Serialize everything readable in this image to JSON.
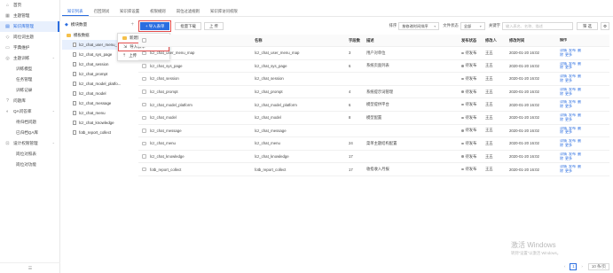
{
  "nav": {
    "items": [
      {
        "label": "首页",
        "icon": "home-icon",
        "type": "top"
      },
      {
        "label": "主题管理",
        "icon": "grid-icon",
        "type": "top"
      },
      {
        "label": "知识库管理",
        "icon": "book-icon",
        "type": "active"
      },
      {
        "label": "岗位词主题",
        "icon": "tag-icon",
        "type": "top"
      },
      {
        "label": "字典维护",
        "icon": "dict-icon",
        "type": "top"
      },
      {
        "label": "主题训练",
        "icon": "train-icon",
        "type": "group"
      },
      {
        "label": "训练模型",
        "icon": "",
        "type": "sub"
      },
      {
        "label": "任务管理",
        "icon": "",
        "type": "sub"
      },
      {
        "label": "训练记录",
        "icon": "",
        "type": "sub"
      },
      {
        "label": "问题库",
        "icon": "question-icon",
        "type": "top"
      },
      {
        "label": "QA问答库",
        "icon": "qa-icon",
        "type": "group"
      },
      {
        "label": "待归档问题",
        "icon": "",
        "type": "sub"
      },
      {
        "label": "已归档QA库",
        "icon": "",
        "type": "sub"
      },
      {
        "label": "设计权限管理",
        "icon": "lock-icon",
        "type": "group"
      },
      {
        "label": "岗位对照表",
        "icon": "",
        "type": "sub"
      },
      {
        "label": "岗位对功能",
        "icon": "",
        "type": "sub"
      }
    ],
    "footer_icon": "collapse-icon"
  },
  "tabs": [
    {
      "label": "知识列表",
      "active": true
    },
    {
      "label": "召回测试",
      "active": false
    },
    {
      "label": "知识库设置",
      "active": false
    },
    {
      "label": "权限规则",
      "active": false
    },
    {
      "label": "岗位过滤规则",
      "active": false
    },
    {
      "label": "知识库访问权限",
      "active": false
    }
  ],
  "tree": {
    "root_label": "模块数量",
    "root_plus": "+",
    "nodes": [
      {
        "label": "模板数据",
        "kind": "folder",
        "level": 0
      },
      {
        "label": "lcz_chat_user_menu_m...",
        "kind": "file",
        "level": 1
      },
      {
        "label": "lcz_chat_sys_page",
        "kind": "file",
        "level": 1
      },
      {
        "label": "lcz_chat_session",
        "kind": "file",
        "level": 1
      },
      {
        "label": "lcz_chat_prompt",
        "kind": "file",
        "level": 1
      },
      {
        "label": "lcz_chat_model_platfo...",
        "kind": "file",
        "level": 1
      },
      {
        "label": "lcz_chat_model",
        "kind": "file",
        "level": 1
      },
      {
        "label": "lcz_chat_message",
        "kind": "file",
        "level": 1
      },
      {
        "label": "lcz_chat_menu",
        "kind": "file",
        "level": 1
      },
      {
        "label": "lcz_chat_knowledge",
        "kind": "file",
        "level": 1
      },
      {
        "label": "fotb_report_collect",
        "kind": "file",
        "level": 1
      }
    ]
  },
  "context_menu": {
    "items": [
      {
        "label": "新建目录",
        "icon": "folder-icon"
      },
      {
        "label": "导入表单",
        "icon": "import-icon",
        "highlight": true
      },
      {
        "label": "上传",
        "icon": "upload-icon"
      }
    ]
  },
  "toolbar": {
    "import_label": "+ 导入表单",
    "download_label": "批量下载",
    "upload_label": "上 传",
    "sort_label": "排序",
    "sort_value": "按修改时间排序",
    "status_label": "文件状态",
    "status_value": "全部",
    "keyword_label": "关键字",
    "keyword_placeholder": "输入表名、名称、描述",
    "filter_label": "筛 选"
  },
  "table": {
    "headers": [
      "",
      "名称",
      "字段数",
      "描述",
      "发布状态",
      "修改人",
      "修改时间",
      "操作"
    ],
    "code_header": "",
    "rows": [
      {
        "code": "lcz_chat_user_menu_map",
        "name": "lcz_chat_user_menu_map",
        "count": "3",
        "desc": "用户对单位",
        "status": "待发布",
        "user": "王五",
        "time": "2020-01-20 16:02"
      },
      {
        "code": "lcz_chat_sys_page",
        "name": "lcz_chat_sys_page",
        "count": "6",
        "desc": "系统页面列表",
        "status": "待发布",
        "user": "王五",
        "time": "2020-01-20 16:02"
      },
      {
        "code": "lcz_chat_session",
        "name": "lcz_chat_session",
        "count": "",
        "desc": "",
        "status": "待发布",
        "user": "王五",
        "time": "2020-01-20 16:02"
      },
      {
        "code": "lcz_chat_prompt",
        "name": "lcz_chat_prompt",
        "count": "4",
        "desc": "系统提示词管理",
        "status": "待发布",
        "user": "王五",
        "time": "2020-01-20 16:02"
      },
      {
        "code": "lcz_chat_model_platform",
        "name": "lcz_chat_model_platform",
        "count": "6",
        "desc": "模型提供平台",
        "status": "待发布",
        "user": "王五",
        "time": "2020-01-20 16:02"
      },
      {
        "code": "lcz_chat_model",
        "name": "lcz_chat_model",
        "count": "8",
        "desc": "模型配置",
        "status": "待发布",
        "user": "王五",
        "time": "2020-01-20 16:02"
      },
      {
        "code": "lcz_chat_message",
        "name": "lcz_chat_message",
        "count": "",
        "desc": "",
        "status": "待发布",
        "user": "王五",
        "time": "2020-01-20 16:02"
      },
      {
        "code": "lcz_chat_menu",
        "name": "lcz_chat_menu",
        "count": "24",
        "desc": "菜单主题结构配置",
        "status": "待发布",
        "user": "王五",
        "time": "2020-01-20 16:02"
      },
      {
        "code": "lcz_chat_knowledge",
        "name": "lcz_chat_knowledge",
        "count": "17",
        "desc": "",
        "status": "待发布",
        "user": "王五",
        "time": "2020-01-20 16:02"
      },
      {
        "code": "fotb_report_collect",
        "name": "fotb_report_collect",
        "count": "17",
        "desc": "收指收入月报",
        "status": "待发布",
        "user": "王五",
        "time": "2020-01-20 16:02"
      }
    ],
    "row_ops": [
      "详情",
      "发布",
      "删除",
      "更多"
    ]
  },
  "pager": {
    "page": "1",
    "size": "10 条/页"
  },
  "watermark": {
    "line1": "激活 Windows",
    "line2": "转到\"设置\"以激活 Windows。"
  },
  "colors": {
    "accent": "#2a6de0",
    "highlight_border": "#e24c4c",
    "folder": "#f5c04a"
  }
}
